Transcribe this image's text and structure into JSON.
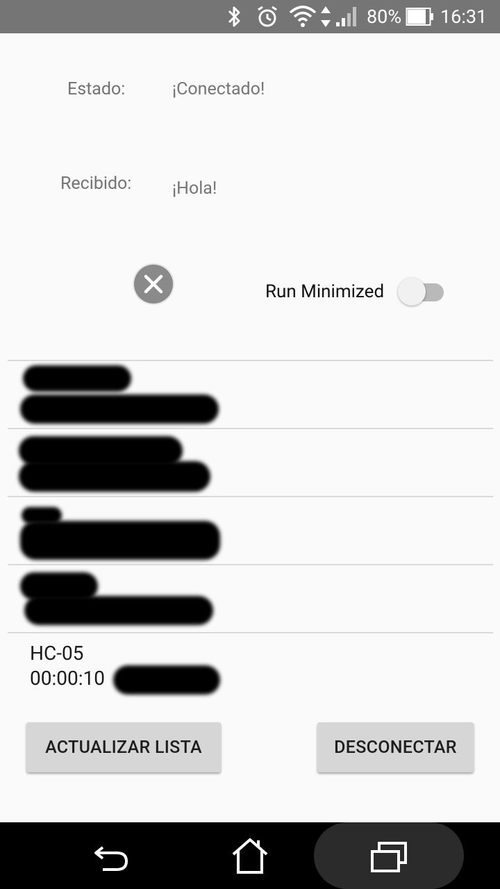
{
  "status_bar": {
    "battery": "80%",
    "time": "16:31",
    "icons": [
      "bluetooth-icon",
      "alarm-icon",
      "wifi-icon",
      "signal-icon",
      "battery-icon"
    ]
  },
  "estado": {
    "label": "Estado:",
    "value": "¡Conectado!"
  },
  "recibido": {
    "label": "Recibido:",
    "value": "¡Hola!"
  },
  "run_minimized": {
    "label": "Run Minimized",
    "checked": false
  },
  "devices": [
    {
      "name": "",
      "address": ""
    },
    {
      "name": "",
      "address": ""
    },
    {
      "name": "",
      "address": ""
    },
    {
      "name": "",
      "address": ""
    },
    {
      "name": "HC-05",
      "address": "00:00:10"
    }
  ],
  "buttons": {
    "refresh": "ACTUALIZAR LISTA",
    "disconnect": "DESCONECTAR"
  },
  "nav": [
    "back-icon",
    "home-icon",
    "recents-icon"
  ],
  "colors": {
    "status_bar": "#757575",
    "background": "#fafafa",
    "button": "#d6d6d6"
  }
}
